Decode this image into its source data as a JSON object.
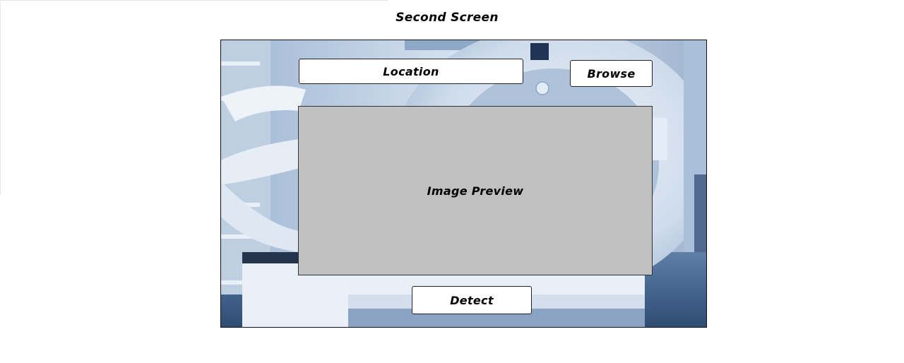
{
  "screen": {
    "title": "Second Screen"
  },
  "form": {
    "location_label": "Location",
    "browse_label": "Browse",
    "preview_label": "Image Preview",
    "detect_label": "Detect"
  },
  "colors": {
    "preview_fill": "#c0c0c0",
    "background_tint": "#bcd0e6"
  }
}
